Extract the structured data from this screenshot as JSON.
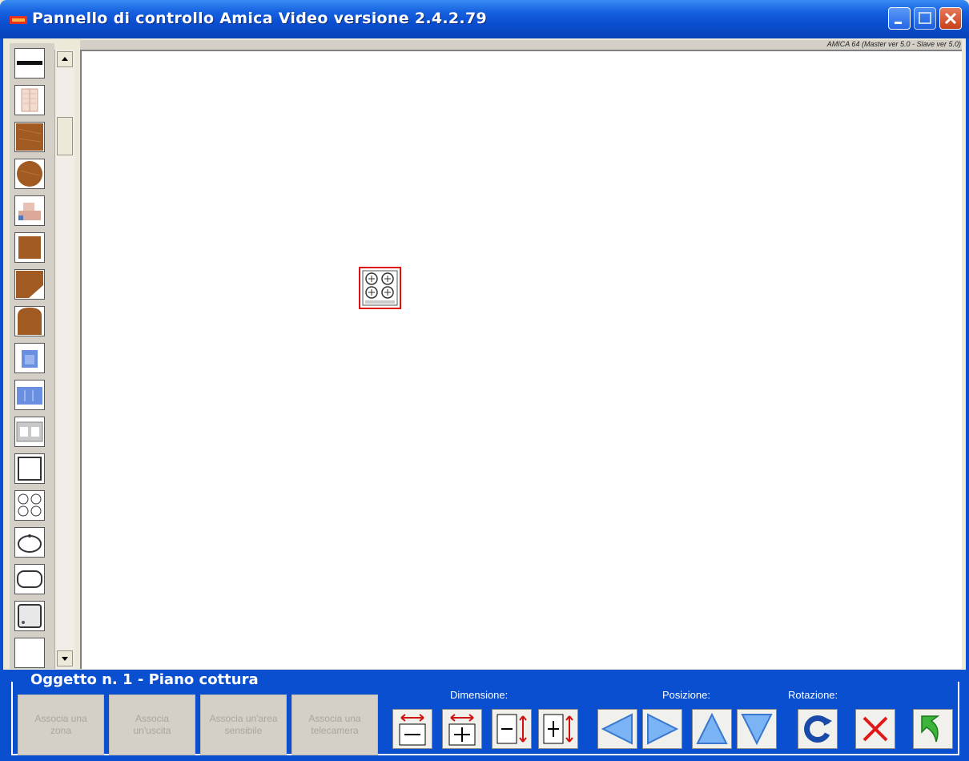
{
  "window": {
    "title": "Pannello di controllo Amica Video versione 2.4.2.79"
  },
  "canvas": {
    "version_label": "AMICA 64 (Master ver 5.0 - Slave ver 5.0)"
  },
  "palette": {
    "items": [
      {
        "name": "wall-line-icon"
      },
      {
        "name": "wardrobe-icon"
      },
      {
        "name": "wood-square-icon"
      },
      {
        "name": "wood-round-table-icon"
      },
      {
        "name": "sofa-icon"
      },
      {
        "name": "wood-small-square-icon"
      },
      {
        "name": "wood-corner-icon"
      },
      {
        "name": "wood-rounded-icon"
      },
      {
        "name": "armchair-icon"
      },
      {
        "name": "sofa-blue-icon"
      },
      {
        "name": "cabinet-icon"
      },
      {
        "name": "bathtub-square-icon"
      },
      {
        "name": "cooktop-icon"
      },
      {
        "name": "sink-icon"
      },
      {
        "name": "bathtub-icon"
      },
      {
        "name": "shower-icon"
      }
    ]
  },
  "object_panel": {
    "title": "Oggetto n. 1 - Piano cottura",
    "buttons": {
      "zone": "Associa una zona",
      "output": "Associa un'uscita",
      "area": "Associa un'area sensibile",
      "camera": "Associa una telecamera"
    },
    "sections": {
      "dimension": "Dimensione:",
      "position": "Posizione:",
      "rotation": "Rotazione:"
    }
  }
}
